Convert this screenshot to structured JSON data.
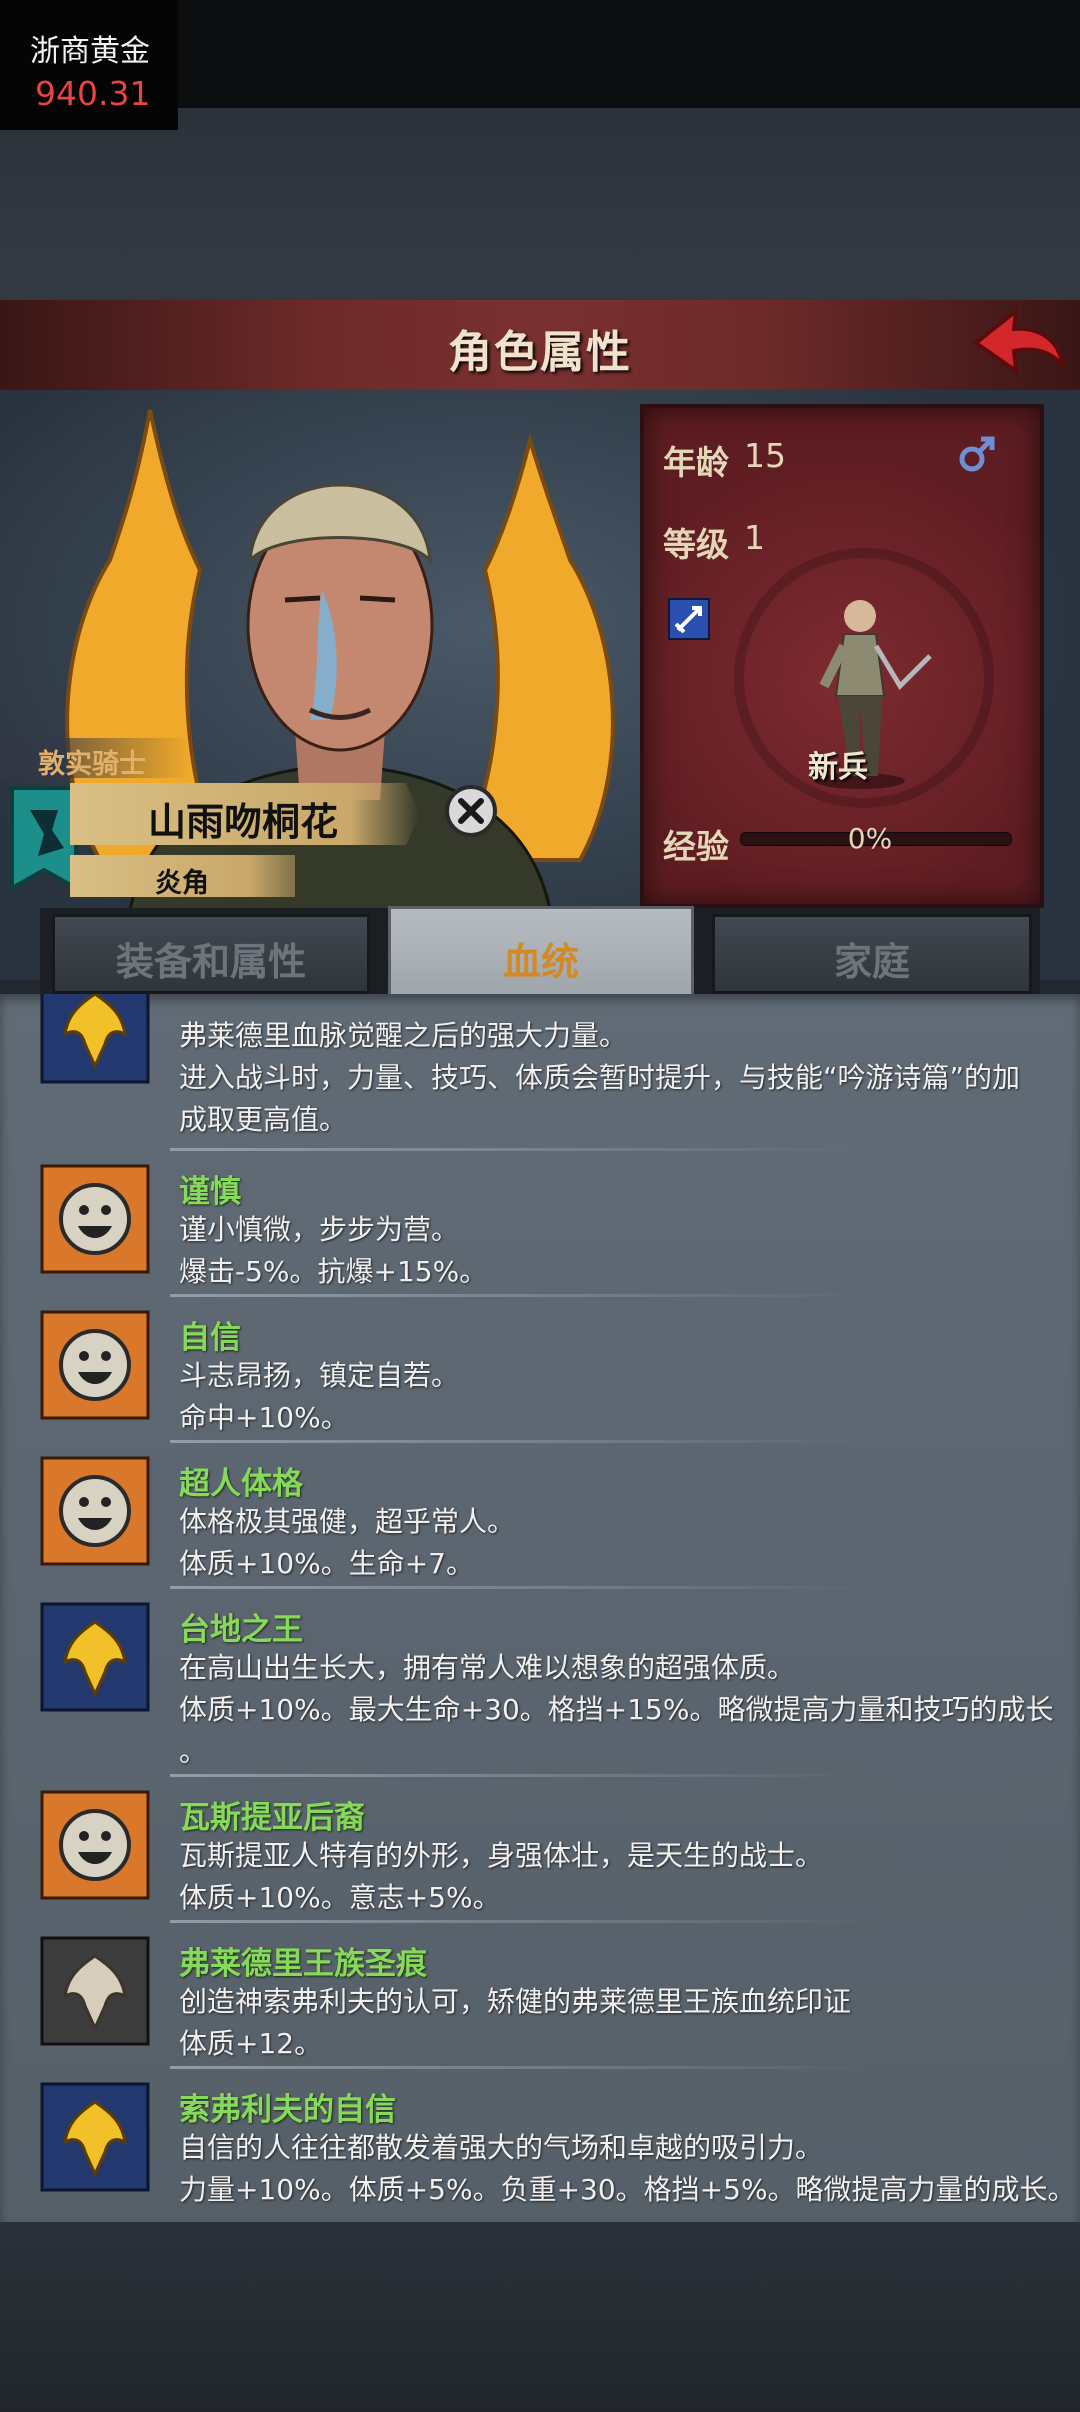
{
  "ticker": {
    "name": "浙商黄金",
    "price": "940.31"
  },
  "header": {
    "title": "角色属性"
  },
  "character": {
    "title": "敦实骑士",
    "name": "山雨吻桐花",
    "subtitle": "炎角",
    "age_label": "年龄",
    "age": "15",
    "level_label": "等级",
    "level": "1",
    "rank": "新兵",
    "exp_label": "经验",
    "exp": "0%"
  },
  "tabs": [
    "装备和属性",
    "血统",
    "家庭"
  ],
  "active_tab": 1,
  "traits": [
    {
      "icon": "blue-gold-crest-icon",
      "name": "",
      "lines": [
        "弗莱德里血脉觉醒之后的强大力量。",
        "进入战斗时，力量、技巧、体质会暂时提升，与技能“吟游诗篇”的加",
        "成取更高值。"
      ]
    },
    {
      "icon": "smiley-face-icon",
      "name": "谨慎",
      "lines": [
        "谨小慎微，步步为营。",
        "爆击-5%。抗爆+15%。"
      ]
    },
    {
      "icon": "smiley-face-icon",
      "name": "自信",
      "lines": [
        "斗志昂扬，镇定自若。",
        "命中+10%。"
      ]
    },
    {
      "icon": "smiley-face-icon",
      "name": "超人体格",
      "lines": [
        "体格极其强健，超乎常人。",
        "体质+10%。生命+7。"
      ]
    },
    {
      "icon": "blue-gold-crest-icon",
      "name": "台地之王",
      "lines": [
        "在高山出生长大，拥有常人难以想象的超强体质。",
        "体质+10%。最大生命+30。格挡+15%。略微提高力量和技巧的成长",
        "。"
      ]
    },
    {
      "icon": "smiley-face-icon",
      "name": "瓦斯提亚后裔",
      "lines": [
        "瓦斯提亚人特有的外形，身强体壮，是天生的战士。",
        "体质+10%。意志+5%。"
      ]
    },
    {
      "icon": "silver-crest-icon",
      "name": "弗莱德里王族圣痕",
      "lines": [
        "创造神索弗利夫的认可，矫健的弗莱德里王族血统印证",
        "体质+12。"
      ]
    },
    {
      "icon": "blue-gold-crest-icon",
      "name": "索弗利夫的自信",
      "lines": [
        "自信的人往往都散发着强大的气场和卓越的吸引力。",
        "力量+10%。体质+5%。负重+30。格挡+5%。略微提高力量的成长。"
      ]
    }
  ]
}
